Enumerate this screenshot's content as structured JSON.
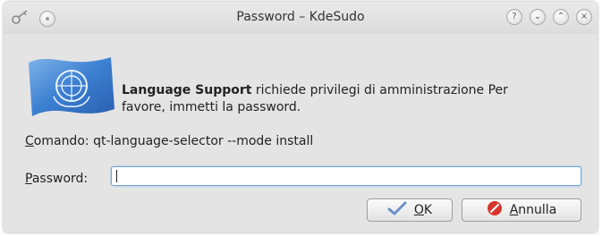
{
  "window": {
    "title": "Password – KdeSudo",
    "help_symbol": "?",
    "minimize_symbol": "⌄",
    "maximize_symbol": "⌃",
    "close_symbol": "×"
  },
  "message": {
    "app_name": "Language Support",
    "text_line1": " richiede privilegi di amministrazione Per",
    "text_line2": "favore, immetti la password."
  },
  "command": {
    "label_underlined": "C",
    "label_rest": "omando:",
    "value": "qt-language-selector --mode install"
  },
  "password": {
    "label_underlined": "P",
    "label_rest": "assword:",
    "value": ""
  },
  "buttons": {
    "ok_underlined": "O",
    "ok_rest": "K",
    "cancel_underlined": "A",
    "cancel_rest": "nnulla"
  },
  "colors": {
    "accent": "#6fa6d6",
    "cancel_icon": "#d9342b",
    "ok_icon": "#6b8fc9"
  },
  "icons": [
    "key-icon",
    "pin-icon",
    "help-icon",
    "minimize-icon",
    "maximize-icon",
    "close-icon",
    "un-flag-icon",
    "checkmark-icon",
    "cancel-icon"
  ]
}
